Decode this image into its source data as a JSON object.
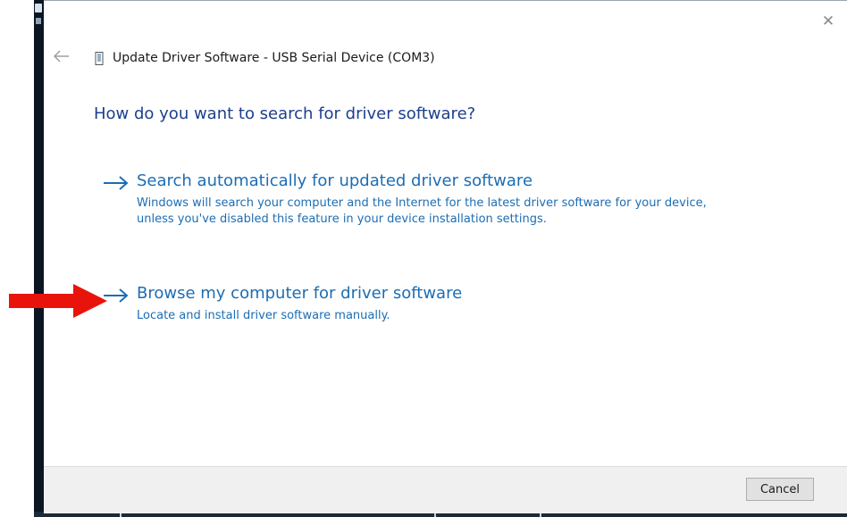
{
  "dialog": {
    "window_title": "Update Driver Software - USB Serial Device (COM3)",
    "close_symbol": "✕",
    "heading": "How do you want to search for driver software?",
    "options": [
      {
        "title": "Search automatically for updated driver software",
        "description": "Windows will search your computer and the Internet for the latest driver software for your device, unless you've disabled this feature in your device installation settings."
      },
      {
        "title": "Browse my computer for driver software",
        "description": "Locate and install driver software manually."
      }
    ],
    "cancel_label": "Cancel"
  },
  "icons": {
    "back": "back-arrow-icon",
    "device": "usb-device-icon",
    "option_arrow": "right-arrow-icon",
    "annotation": "red-pointer-arrow"
  },
  "colors": {
    "heading": "#1c3f8c",
    "link": "#1c6db4",
    "annotation": "#e8140c",
    "footer": "#f0f0f0"
  }
}
